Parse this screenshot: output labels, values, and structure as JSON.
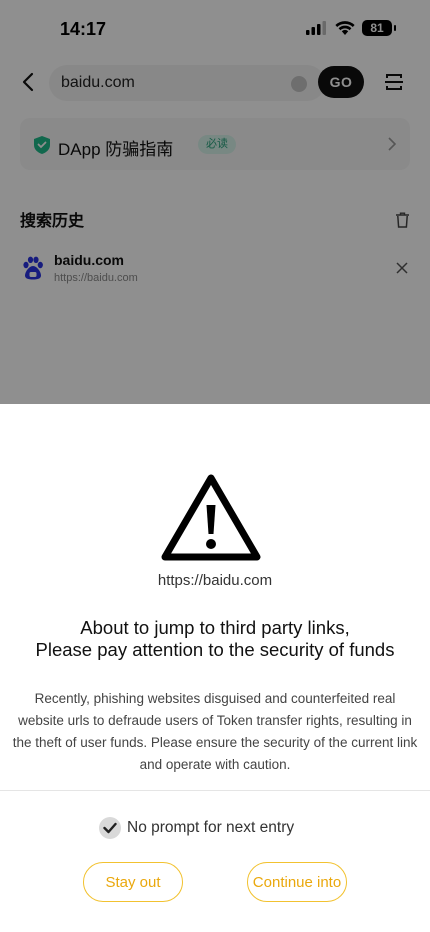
{
  "status_bar": {
    "time": "14:17",
    "battery": "81"
  },
  "browser": {
    "url_value": "baidu.com",
    "go_label": "GO"
  },
  "dapp_banner": {
    "title": "DApp 防骗指南",
    "badge": "必读"
  },
  "history": {
    "title": "搜索历史",
    "items": [
      {
        "name": "baidu.com",
        "url": "https://baidu.com"
      }
    ]
  },
  "dialog": {
    "url": "https://baidu.com",
    "headline_line1": "About to jump to third party links,",
    "headline_line2": "Please pay attention to the security of funds",
    "description": "Recently, phishing websites disguised and counterfeited real website urls to defraude users of Token transfer rights, resulting in the theft of user funds. Please ensure the security of the current link and operate with caution.",
    "no_prompt_label": "No prompt for next entry",
    "no_prompt_checked": true,
    "stay_label": "Stay out",
    "continue_label": "Continue into"
  },
  "colors": {
    "accent_yellow": "#f2c230",
    "accent_text": "#eaa80d",
    "brand_green": "#2aa27d",
    "overlay": "rgba(0,0,0,0.44)"
  },
  "icons": [
    "signal-icon",
    "wifi-icon",
    "back-arrow-icon",
    "clear-icon",
    "scan-icon",
    "shield-icon",
    "chevron-right-icon",
    "trash-icon",
    "baidu-paw-icon",
    "close-icon",
    "warning-triangle-icon",
    "checkmark-icon"
  ]
}
